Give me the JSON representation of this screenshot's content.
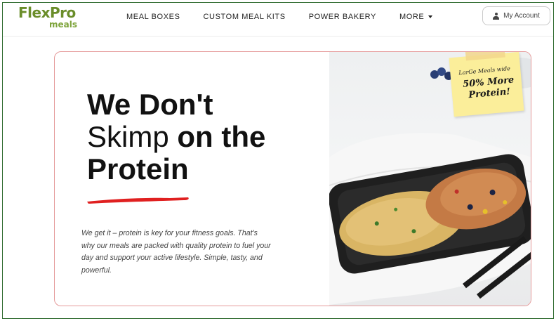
{
  "header": {
    "logo": {
      "brand_top": "Flex",
      "brand_top_b": "Pro",
      "brand_bottom": "meals"
    },
    "nav": [
      {
        "label": "MEAL BOXES"
      },
      {
        "label": "CUSTOM MEAL KITS"
      },
      {
        "label": "POWER BAKERY"
      },
      {
        "label": "MORE"
      }
    ],
    "account_label": "My Account"
  },
  "hero": {
    "headline_line1": "We Don't",
    "headline_line2_light": "Skimp",
    "headline_line2_bold": "on the",
    "headline_line3": "Protein",
    "body": "We get it – protein is key for your fitness goals. That's why our meals are packed with quality protein to fuel your day and support your active lifestyle. Simple, tasty, and powerful.",
    "sticky_small": "LarGe Meals wide",
    "sticky_big": "50% More Protein!"
  },
  "colors": {
    "brand_green": "#6a8d2a",
    "card_border": "#e59a9a",
    "accent_red": "#e02020",
    "sticky_yellow": "#fbee9a"
  }
}
